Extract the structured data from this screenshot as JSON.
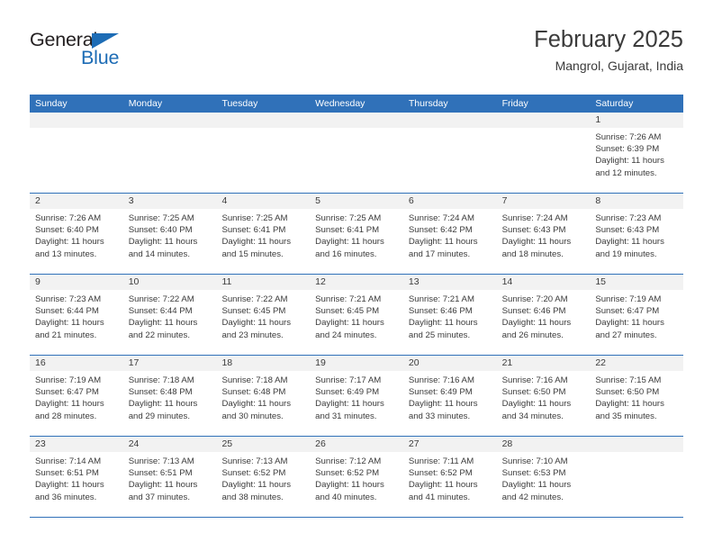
{
  "brand": {
    "name_part1": "General",
    "name_part2": "Blue",
    "accent_color": "#1d6cb5"
  },
  "header": {
    "title": "February 2025",
    "subtitle": "Mangrol, Gujarat, India"
  },
  "theme": {
    "header_blue": "#3071b9",
    "daynum_band": "#f2f2f2",
    "text": "#3b3b3b"
  },
  "weekday_headers": [
    "Sunday",
    "Monday",
    "Tuesday",
    "Wednesday",
    "Thursday",
    "Friday",
    "Saturday"
  ],
  "weeks": [
    [
      {
        "day": "",
        "empty": true
      },
      {
        "day": "",
        "empty": true
      },
      {
        "day": "",
        "empty": true
      },
      {
        "day": "",
        "empty": true
      },
      {
        "day": "",
        "empty": true
      },
      {
        "day": "",
        "empty": true
      },
      {
        "day": "1",
        "sunrise": "Sunrise: 7:26 AM",
        "sunset": "Sunset: 6:39 PM",
        "daylight": "Daylight: 11 hours and 12 minutes."
      }
    ],
    [
      {
        "day": "2",
        "sunrise": "Sunrise: 7:26 AM",
        "sunset": "Sunset: 6:40 PM",
        "daylight": "Daylight: 11 hours and 13 minutes."
      },
      {
        "day": "3",
        "sunrise": "Sunrise: 7:25 AM",
        "sunset": "Sunset: 6:40 PM",
        "daylight": "Daylight: 11 hours and 14 minutes."
      },
      {
        "day": "4",
        "sunrise": "Sunrise: 7:25 AM",
        "sunset": "Sunset: 6:41 PM",
        "daylight": "Daylight: 11 hours and 15 minutes."
      },
      {
        "day": "5",
        "sunrise": "Sunrise: 7:25 AM",
        "sunset": "Sunset: 6:41 PM",
        "daylight": "Daylight: 11 hours and 16 minutes."
      },
      {
        "day": "6",
        "sunrise": "Sunrise: 7:24 AM",
        "sunset": "Sunset: 6:42 PM",
        "daylight": "Daylight: 11 hours and 17 minutes."
      },
      {
        "day": "7",
        "sunrise": "Sunrise: 7:24 AM",
        "sunset": "Sunset: 6:43 PM",
        "daylight": "Daylight: 11 hours and 18 minutes."
      },
      {
        "day": "8",
        "sunrise": "Sunrise: 7:23 AM",
        "sunset": "Sunset: 6:43 PM",
        "daylight": "Daylight: 11 hours and 19 minutes."
      }
    ],
    [
      {
        "day": "9",
        "sunrise": "Sunrise: 7:23 AM",
        "sunset": "Sunset: 6:44 PM",
        "daylight": "Daylight: 11 hours and 21 minutes."
      },
      {
        "day": "10",
        "sunrise": "Sunrise: 7:22 AM",
        "sunset": "Sunset: 6:44 PM",
        "daylight": "Daylight: 11 hours and 22 minutes."
      },
      {
        "day": "11",
        "sunrise": "Sunrise: 7:22 AM",
        "sunset": "Sunset: 6:45 PM",
        "daylight": "Daylight: 11 hours and 23 minutes."
      },
      {
        "day": "12",
        "sunrise": "Sunrise: 7:21 AM",
        "sunset": "Sunset: 6:45 PM",
        "daylight": "Daylight: 11 hours and 24 minutes."
      },
      {
        "day": "13",
        "sunrise": "Sunrise: 7:21 AM",
        "sunset": "Sunset: 6:46 PM",
        "daylight": "Daylight: 11 hours and 25 minutes."
      },
      {
        "day": "14",
        "sunrise": "Sunrise: 7:20 AM",
        "sunset": "Sunset: 6:46 PM",
        "daylight": "Daylight: 11 hours and 26 minutes."
      },
      {
        "day": "15",
        "sunrise": "Sunrise: 7:19 AM",
        "sunset": "Sunset: 6:47 PM",
        "daylight": "Daylight: 11 hours and 27 minutes."
      }
    ],
    [
      {
        "day": "16",
        "sunrise": "Sunrise: 7:19 AM",
        "sunset": "Sunset: 6:47 PM",
        "daylight": "Daylight: 11 hours and 28 minutes."
      },
      {
        "day": "17",
        "sunrise": "Sunrise: 7:18 AM",
        "sunset": "Sunset: 6:48 PM",
        "daylight": "Daylight: 11 hours and 29 minutes."
      },
      {
        "day": "18",
        "sunrise": "Sunrise: 7:18 AM",
        "sunset": "Sunset: 6:48 PM",
        "daylight": "Daylight: 11 hours and 30 minutes."
      },
      {
        "day": "19",
        "sunrise": "Sunrise: 7:17 AM",
        "sunset": "Sunset: 6:49 PM",
        "daylight": "Daylight: 11 hours and 31 minutes."
      },
      {
        "day": "20",
        "sunrise": "Sunrise: 7:16 AM",
        "sunset": "Sunset: 6:49 PM",
        "daylight": "Daylight: 11 hours and 33 minutes."
      },
      {
        "day": "21",
        "sunrise": "Sunrise: 7:16 AM",
        "sunset": "Sunset: 6:50 PM",
        "daylight": "Daylight: 11 hours and 34 minutes."
      },
      {
        "day": "22",
        "sunrise": "Sunrise: 7:15 AM",
        "sunset": "Sunset: 6:50 PM",
        "daylight": "Daylight: 11 hours and 35 minutes."
      }
    ],
    [
      {
        "day": "23",
        "sunrise": "Sunrise: 7:14 AM",
        "sunset": "Sunset: 6:51 PM",
        "daylight": "Daylight: 11 hours and 36 minutes."
      },
      {
        "day": "24",
        "sunrise": "Sunrise: 7:13 AM",
        "sunset": "Sunset: 6:51 PM",
        "daylight": "Daylight: 11 hours and 37 minutes."
      },
      {
        "day": "25",
        "sunrise": "Sunrise: 7:13 AM",
        "sunset": "Sunset: 6:52 PM",
        "daylight": "Daylight: 11 hours and 38 minutes."
      },
      {
        "day": "26",
        "sunrise": "Sunrise: 7:12 AM",
        "sunset": "Sunset: 6:52 PM",
        "daylight": "Daylight: 11 hours and 40 minutes."
      },
      {
        "day": "27",
        "sunrise": "Sunrise: 7:11 AM",
        "sunset": "Sunset: 6:52 PM",
        "daylight": "Daylight: 11 hours and 41 minutes."
      },
      {
        "day": "28",
        "sunrise": "Sunrise: 7:10 AM",
        "sunset": "Sunset: 6:53 PM",
        "daylight": "Daylight: 11 hours and 42 minutes."
      },
      {
        "day": "",
        "empty": true
      }
    ]
  ]
}
